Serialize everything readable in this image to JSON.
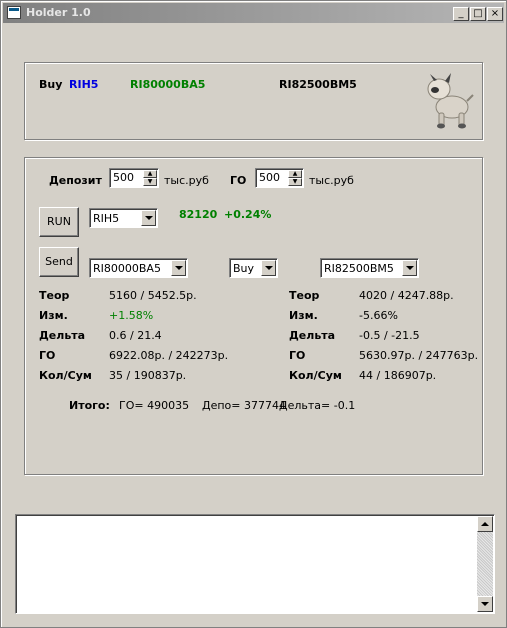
{
  "window": {
    "title": "Holder 1.0",
    "minimize": "_",
    "maximize": "□",
    "close": "×"
  },
  "header": {
    "buy_label": "Buy",
    "ticker_main": "RIH5",
    "ticker_option1": "RI80000BA5",
    "ticker_option2": "RI82500BM5",
    "mascot_icon": "robot-dog-icon"
  },
  "params": {
    "deposit_label": "Депозит",
    "deposit_value": "500",
    "deposit_unit": "тыс.руб",
    "go_label": "ГО",
    "go_value": "500",
    "go_unit": "тыс.руб"
  },
  "run": {
    "button": "RUN",
    "instrument": "RIH5",
    "price": "82120",
    "change": "+0.24%"
  },
  "send": {
    "button": "Send",
    "option1": "RI80000BA5",
    "side": "Buy",
    "option2": "RI82500BM5"
  },
  "left": {
    "rows": [
      {
        "label": "Теор",
        "value": "5160 / 5452.5р."
      },
      {
        "label": "Изм.",
        "value": "+1.58%"
      },
      {
        "label": "Дельта",
        "value": "0.6 / 21.4"
      },
      {
        "label": "ГО",
        "value": "6922.08р. / 242273р."
      },
      {
        "label": "Кол/Сум",
        "value": "35 / 190837р."
      }
    ]
  },
  "right": {
    "rows": [
      {
        "label": "Теор",
        "value": "4020 / 4247.88р."
      },
      {
        "label": "Изм.",
        "value": "-5.66%"
      },
      {
        "label": "Дельта",
        "value": "-0.5 / -21.5"
      },
      {
        "label": "ГО",
        "value": "5630.97р. / 247763р."
      },
      {
        "label": "Кол/Сум",
        "value": "44 / 186907р."
      }
    ]
  },
  "total": {
    "label": "Итого:",
    "go": "ГО= 490035",
    "depo": "Депо= 377744",
    "delta": "Дельта= -0.1"
  },
  "colors": {
    "blue": "#0000e0",
    "green": "#008000"
  }
}
